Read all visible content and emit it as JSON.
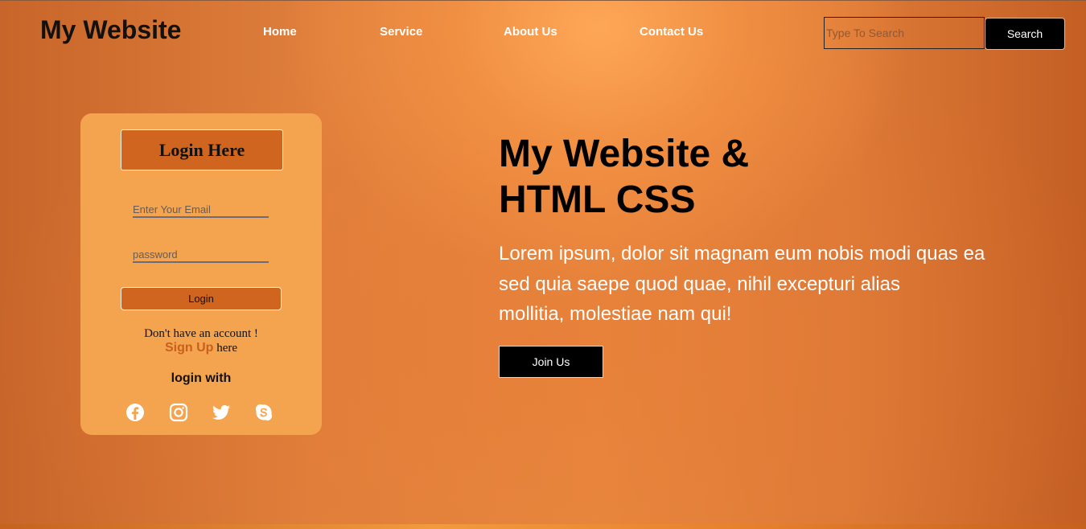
{
  "header": {
    "logo": "My Website",
    "nav": [
      {
        "label": "Home"
      },
      {
        "label": "Service"
      },
      {
        "label": "About Us"
      },
      {
        "label": "Contact Us"
      }
    ],
    "search": {
      "placeholder": "Type To Search",
      "value": "",
      "button_label": "Search"
    }
  },
  "login": {
    "title": "Login Here",
    "email_placeholder": "Enter Your Email",
    "password_placeholder": "password",
    "button_label": "Login",
    "account_text": "Don't have an account !",
    "signup_link": "Sign Up",
    "signup_suffix": " here",
    "login_with": "login with",
    "social_icons": [
      "facebook-icon",
      "instagram-icon",
      "twitter-icon",
      "skype-icon"
    ]
  },
  "hero": {
    "title_line1": "My Website &",
    "title_line2": "HTML CSS",
    "text_line1": "Lorem ipsum, dolor sit magnam eum nobis modi quas ea",
    "text_line2": "sed quia saepe quod quae, nihil excepturi alias",
    "text_line3": "mollitia, molestiae nam qui!",
    "button_label": "Join Us"
  },
  "colors": {
    "background": "#e0803c",
    "card": "#f4a44f",
    "accent": "#d0651f",
    "signup_link": "#c8601d"
  }
}
